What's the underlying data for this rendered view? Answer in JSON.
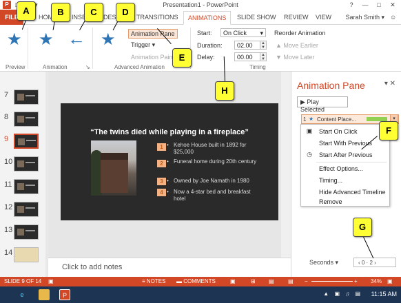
{
  "window": {
    "title": "Presentation1 - PowerPoint",
    "qat": "□ ↶ ↷ ▾",
    "controls": [
      "?",
      "—",
      "□",
      "✕"
    ],
    "user": "Sarah Smith ▾"
  },
  "tabs": {
    "file": "FILE",
    "home": "HOME",
    "insert": "INSERT",
    "design": "DESIGN",
    "transitions": "TRANSITIONS",
    "animations": "ANIMATIONS",
    "slideshow": "SLIDE SHOW",
    "review": "REVIEW",
    "view": "VIEW"
  },
  "ribbon": {
    "groups": {
      "preview": "Preview",
      "animation": "Animation",
      "advanced": "Advanced Animation",
      "timing": "Timing"
    },
    "animation_pane": "Animation Pane",
    "trigger": "Trigger ▾",
    "animation_painter": "Animation Painter",
    "start_label": "Start:",
    "start_value": "On Click",
    "duration_label": "Duration:",
    "duration_value": "02.00",
    "delay_label": "Delay:",
    "delay_value": "00.00",
    "reorder": "Reorder Animation",
    "move_earlier": "▲ Move Earlier",
    "move_later": "▼ Move Later"
  },
  "callouts": [
    "A",
    "B",
    "C",
    "D",
    "E",
    "F",
    "G",
    "H"
  ],
  "thumbnails": [
    "7",
    "8",
    "9",
    "10",
    "11",
    "12",
    "13",
    "14"
  ],
  "selected_thumbnail": "9",
  "slide": {
    "title": "“The twins died while playing in a fireplace”",
    "items": [
      {
        "num": "1",
        "text": "Kehoe House built in 1892 for $25,000"
      },
      {
        "num": "2",
        "text": "Funeral home during 20th century"
      },
      {
        "num": "3",
        "text": "Owned by Joe Namath in 1980"
      },
      {
        "num": "4",
        "text": "Now a 4-star bed and breakfast hotel"
      }
    ]
  },
  "notes_placeholder": "Click to add notes",
  "pane": {
    "title": "Animation Pane",
    "close": "▾ ✕",
    "play": "▶ Play Selected",
    "row_num": "1",
    "row_label": "Content Place...",
    "menu": [
      "Start On Click",
      "Start With Previous",
      "Start After Previous",
      "Effect Options...",
      "Timing...",
      "Hide Advanced Timeline",
      "Remove"
    ],
    "seconds": "Seconds ▾",
    "pager": "‹ 0  ·  2 ›"
  },
  "statusbar": {
    "slide": "SLIDE 9 OF 14",
    "notes": "≡ NOTES",
    "comments": "▬ COMMENTS",
    "zoom": "34%"
  },
  "taskbar": {
    "time": "11:15 AM"
  },
  "colors": {
    "accent": "#d24726",
    "star": "#2e75b6",
    "callout": "#ffff33"
  }
}
